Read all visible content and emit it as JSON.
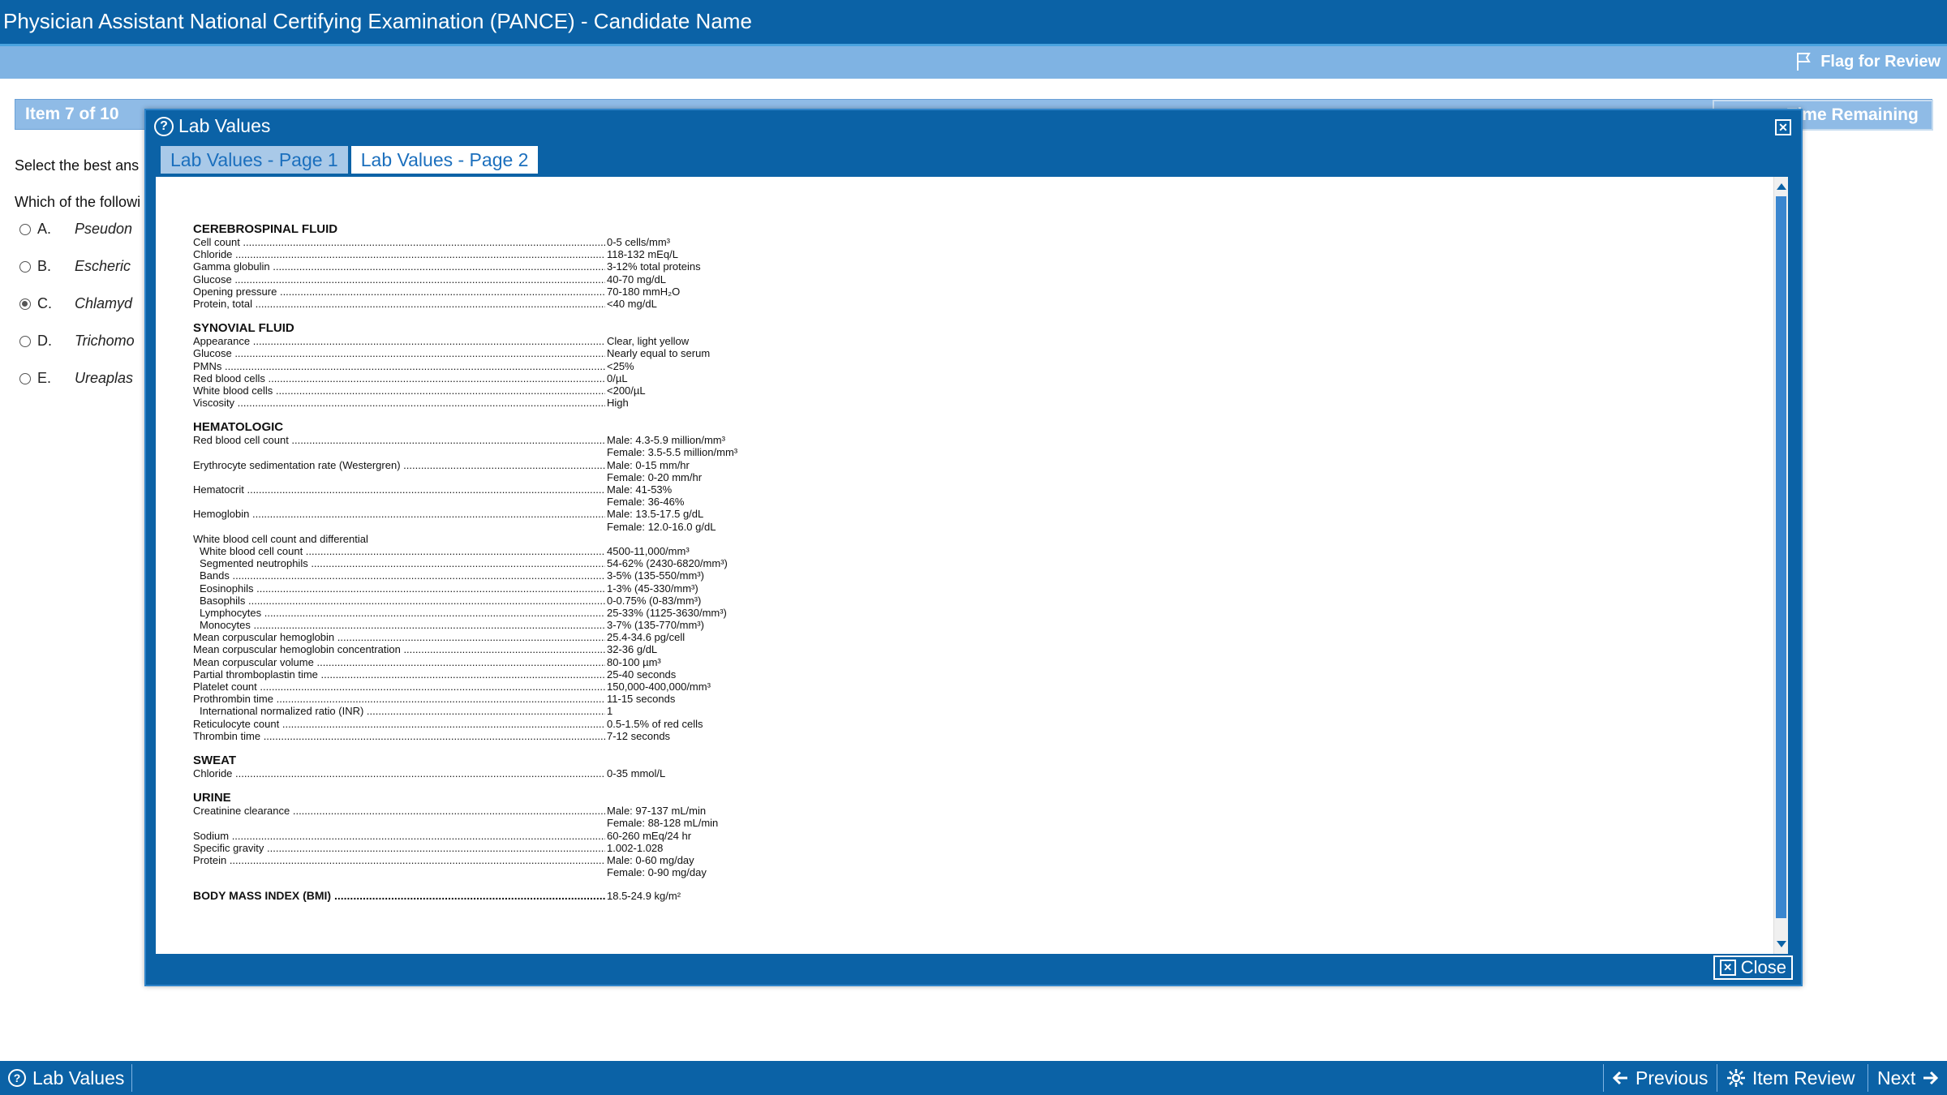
{
  "window": {
    "title": "Physician Assistant National Certifying Examination (PANCE) - Candidate Name"
  },
  "toolbar": {
    "flag_label": "Flag for Review"
  },
  "item": {
    "counter": "Item 7 of 10",
    "time_remaining": "Time Remaining"
  },
  "question": {
    "instruction": "Select the best ans",
    "stem": "Which of the followi",
    "options": [
      {
        "letter": "A.",
        "text": "Pseudon",
        "selected": false
      },
      {
        "letter": "B.",
        "text": "Escheric",
        "selected": false
      },
      {
        "letter": "C.",
        "text": "Chlamyd",
        "selected": true
      },
      {
        "letter": "D.",
        "text": "Trichomo",
        "selected": false
      },
      {
        "letter": "E.",
        "text": "Ureaplas",
        "selected": false
      }
    ]
  },
  "dialog": {
    "title": "Lab Values",
    "help_glyph": "?",
    "close_glyph": "✕",
    "tabs": [
      {
        "label": "Lab Values - Page 1",
        "active": false
      },
      {
        "label": "Lab Values - Page 2",
        "active": true
      }
    ],
    "close_label": "Close",
    "sections": [
      {
        "title": "CEREBROSPINAL FLUID",
        "rows": [
          {
            "name": "Cell count",
            "value": "0-5 cells/mm³"
          },
          {
            "name": "Chloride",
            "value": "118-132 mEq/L"
          },
          {
            "name": "Gamma globulin",
            "value": "3-12% total proteins"
          },
          {
            "name": "Glucose",
            "value": "40-70 mg/dL"
          },
          {
            "name": "Opening pressure",
            "value": "70-180 mmH₂O"
          },
          {
            "name": "Protein, total",
            "value": "<40 mg/dL"
          }
        ]
      },
      {
        "title": "SYNOVIAL FLUID",
        "rows": [
          {
            "name": "Appearance",
            "value": "Clear, light yellow"
          },
          {
            "name": "Glucose",
            "value": "Nearly equal to serum"
          },
          {
            "name": "PMNs",
            "value": "<25%"
          },
          {
            "name": "Red blood cells",
            "value": "0/µL"
          },
          {
            "name": "White blood cells",
            "value": "<200/µL"
          },
          {
            "name": "Viscosity",
            "value": "High"
          }
        ]
      },
      {
        "title": "HEMATOLOGIC",
        "rows": [
          {
            "name": "Red blood cell count",
            "value": "Male: 4.3-5.9 million/mm³"
          },
          {
            "name": "",
            "value": "Female: 3.5-5.5 million/mm³",
            "cont": true
          },
          {
            "name": "Erythrocyte sedimentation rate (Westergren)",
            "value": "Male: 0-15 mm/hr"
          },
          {
            "name": "",
            "value": "Female: 0-20 mm/hr",
            "cont": true
          },
          {
            "name": "Hematocrit",
            "value": "Male: 41-53%"
          },
          {
            "name": "",
            "value": "Female: 36-46%",
            "cont": true
          },
          {
            "name": "Hemoglobin",
            "value": "Male: 13.5-17.5 g/dL"
          },
          {
            "name": "",
            "value": "Female: 12.0-16.0 g/dL",
            "cont": true
          },
          {
            "name": "White blood cell count and differential",
            "value": "",
            "cont": true
          },
          {
            "name": "White blood cell count",
            "value": "4500-11,000/mm³",
            "indent": true
          },
          {
            "name": "Segmented neutrophils",
            "value": "54-62% (2430-6820/mm³)",
            "indent": true
          },
          {
            "name": "Bands",
            "value": "3-5% (135-550/mm³)",
            "indent": true
          },
          {
            "name": "Eosinophils",
            "value": "1-3% (45-330/mm³)",
            "indent": true
          },
          {
            "name": "Basophils",
            "value": "0-0.75% (0-83/mm³)",
            "indent": true
          },
          {
            "name": "Lymphocytes",
            "value": "25-33% (1125-3630/mm³)",
            "indent": true
          },
          {
            "name": "Monocytes",
            "value": "3-7% (135-770/mm³)",
            "indent": true
          },
          {
            "name": "Mean corpuscular hemoglobin",
            "value": "25.4-34.6 pg/cell"
          },
          {
            "name": "Mean corpuscular hemoglobin concentration",
            "value": "32-36 g/dL"
          },
          {
            "name": "Mean corpuscular volume",
            "value": "80-100 µm³"
          },
          {
            "name": "Partial thromboplastin time",
            "value": "25-40 seconds"
          },
          {
            "name": "Platelet count",
            "value": "150,000-400,000/mm³"
          },
          {
            "name": "Prothrombin time",
            "value": "11-15 seconds"
          },
          {
            "name": "International normalized ratio (INR)",
            "value": "1",
            "indent": true
          },
          {
            "name": "Reticulocyte count",
            "value": "0.5-1.5% of red cells"
          },
          {
            "name": "Thrombin time",
            "value": "7-12 seconds"
          }
        ]
      },
      {
        "title": "SWEAT",
        "rows": [
          {
            "name": "Chloride",
            "value": "0-35 mmol/L"
          }
        ]
      },
      {
        "title": "URINE",
        "rows": [
          {
            "name": "Creatinine clearance",
            "value": "Male: 97-137 mL/min"
          },
          {
            "name": "",
            "value": "Female: 88-128 mL/min",
            "cont": true
          },
          {
            "name": "Sodium",
            "value": "60-260 mEq/24 hr"
          },
          {
            "name": "Specific gravity",
            "value": "1.002-1.028"
          },
          {
            "name": "Protein",
            "value": "Male: 0-60 mg/day"
          },
          {
            "name": "",
            "value": "Female: 0-90 mg/day",
            "cont": true
          }
        ]
      }
    ],
    "bmi": {
      "name": "BODY MASS INDEX (BMI)",
      "value": "18.5-24.9 kg/m²"
    }
  },
  "footer": {
    "lab_values_label": "Lab Values",
    "previous_label": "Previous",
    "item_review_label": "Item Review",
    "next_label": "Next"
  },
  "colors": {
    "primary": "#0b62a6",
    "toolbar": "#7fb3e3",
    "tab_text": "#1b6fbd"
  },
  "icons": {
    "flag": "flag-icon",
    "help": "help-circle-icon",
    "close": "close-box-icon",
    "prev": "arrow-left-icon",
    "next": "arrow-right-icon",
    "review": "gear-icon"
  }
}
